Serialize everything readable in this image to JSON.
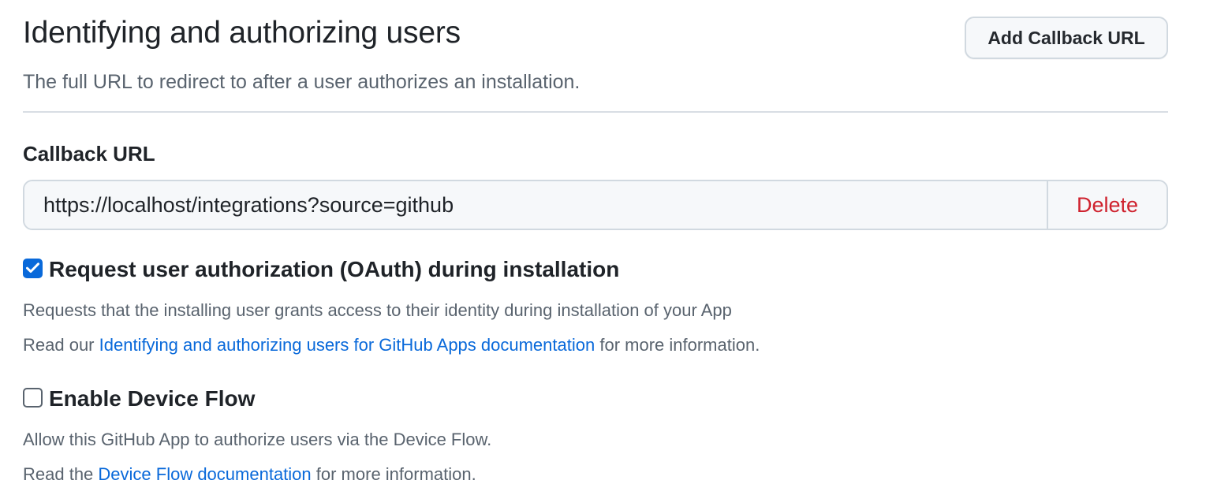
{
  "header": {
    "title": "Identifying and authorizing users",
    "subtitle": "The full URL to redirect to after a user authorizes an installation.",
    "add_callback_label": "Add Callback URL"
  },
  "callback": {
    "label": "Callback URL",
    "value": "https://localhost/integrations?source=github",
    "delete_label": "Delete"
  },
  "oauth": {
    "checked": true,
    "label": "Request user authorization (OAuth) during installation",
    "description": "Requests that the installing user grants access to their identity during installation of your App",
    "read_prefix": "Read our ",
    "link_text": "Identifying and authorizing users for GitHub Apps documentation",
    "read_suffix": " for more information."
  },
  "device_flow": {
    "checked": false,
    "label": "Enable Device Flow",
    "description": "Allow this GitHub App to authorize users via the Device Flow.",
    "read_prefix": "Read the ",
    "link_text": "Device Flow documentation",
    "read_suffix": " for more information."
  },
  "colors": {
    "accent": "#0969da",
    "danger": "#cf222e",
    "muted_text": "#59636e",
    "border": "#d1d9e0"
  }
}
